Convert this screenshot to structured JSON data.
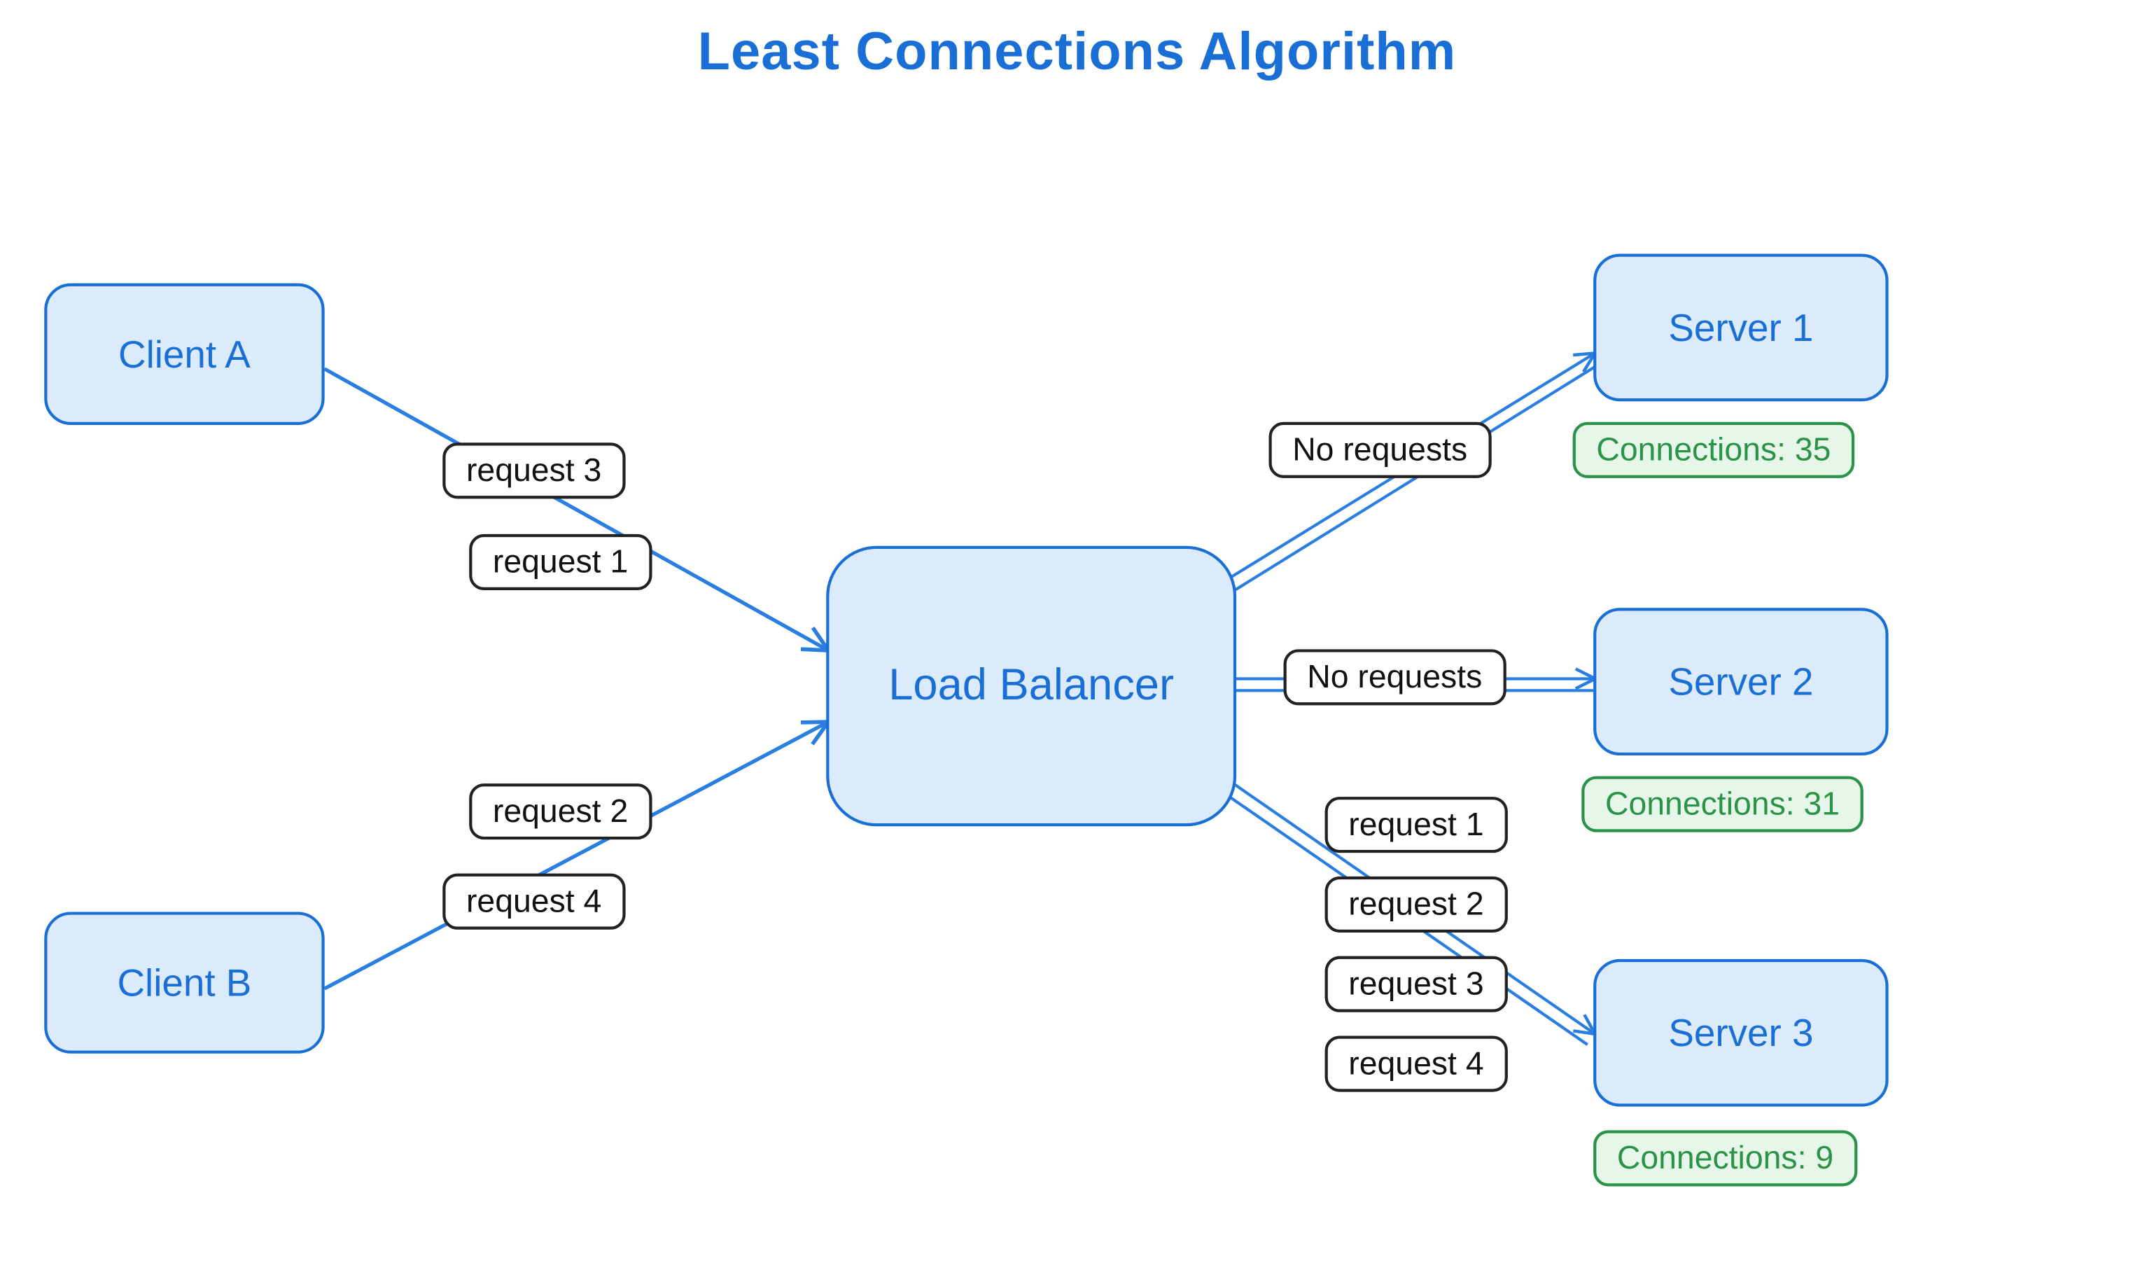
{
  "title": "Least Connections Algorithm",
  "clients": {
    "a": "Client A",
    "b": "Client B"
  },
  "balancer": "Load Balancer",
  "servers": {
    "s1": {
      "label": "Server 1",
      "connections_label": "Connections: 35"
    },
    "s2": {
      "label": "Server 2",
      "connections_label": "Connections: 31"
    },
    "s3": {
      "label": "Server 3",
      "connections_label": "Connections: 9"
    }
  },
  "left_requests": {
    "a1": "request 3",
    "a2": "request 1",
    "b1": "request 2",
    "b2": "request 4"
  },
  "right_labels": {
    "to_s1": "No requests",
    "to_s2": "No requests",
    "to_s3_1": "request 1",
    "to_s3_2": "request 2",
    "to_s3_3": "request 3",
    "to_s3_4": "request 4"
  }
}
